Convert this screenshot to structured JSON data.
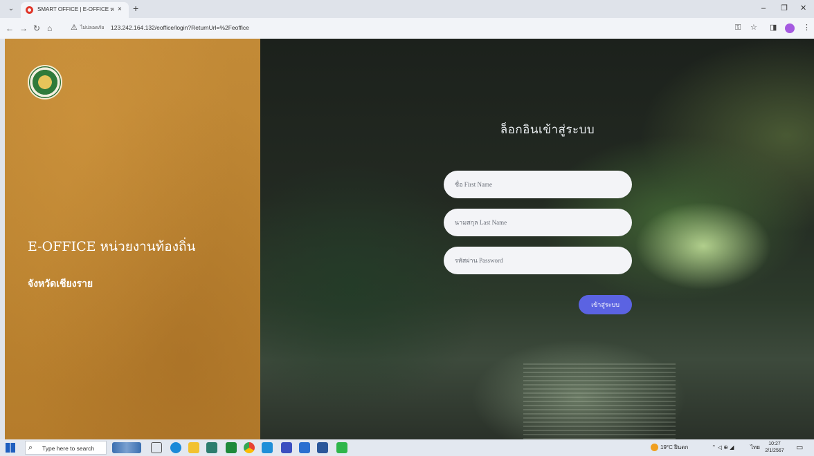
{
  "browser": {
    "tab_title": "SMART OFFICE | E-OFFICE หน่ว...",
    "tab_close": "×",
    "new_tab": "+",
    "insecure_label": "ไม่ปลอดภัย",
    "url": "123.242.164.132/eoffice/login?ReturnUrl=%2Feoffice"
  },
  "sidebar": {
    "app_title": "E-OFFICE หน่วยงานท้องถิ่น",
    "province": "จังหวัดเชียงราย"
  },
  "login": {
    "heading": "ล็อกอินเข้าสู่ระบบ",
    "first_name_placeholder": "ชื่อ First Name",
    "last_name_placeholder": "นามสกุล Last Name",
    "password_placeholder": "รหัสผ่าน Password",
    "submit_label": "เข้าสู่ระบบ"
  },
  "taskbar": {
    "search_placeholder": "Type here to search",
    "weather": "19°C ฝีนตก",
    "language": "ไทย",
    "time": "10:27",
    "date": "2/1/2567"
  },
  "colors": {
    "sidebar_gold": "#bc8431",
    "login_button": "#5b63e2",
    "field_bg": "#f3f4f7"
  }
}
